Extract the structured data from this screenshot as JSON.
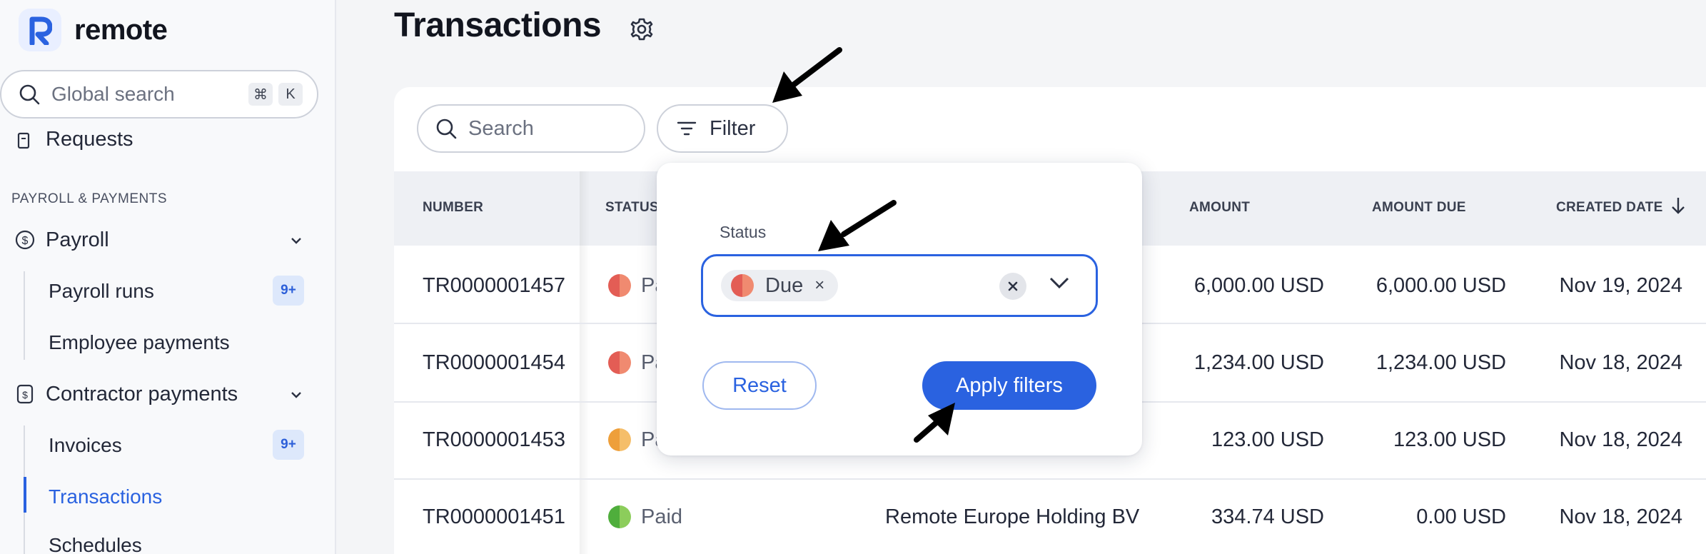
{
  "brand": {
    "name": "remote"
  },
  "global_search": {
    "placeholder": "Global search",
    "key1": "⌘",
    "key2": "K"
  },
  "sidebar": {
    "requests_label": "Requests",
    "section_label": "PAYROLL & PAYMENTS",
    "payroll_label": "Payroll",
    "payroll_runs_label": "Payroll runs",
    "payroll_runs_badge": "9+",
    "employee_payments_label": "Employee payments",
    "contractor_payments_label": "Contractor payments",
    "invoices_label": "Invoices",
    "invoices_badge": "9+",
    "transactions_label": "Transactions",
    "schedules_label": "Schedules"
  },
  "page": {
    "title": "Transactions"
  },
  "toolbar": {
    "search_placeholder": "Search",
    "filter_label": "Filter"
  },
  "table": {
    "headers": {
      "number": "NUMBER",
      "status": "STATUS",
      "amount": "AMOUNT",
      "amount_due": "AMOUNT DUE",
      "created_date": "CREATED DATE"
    },
    "rows": [
      {
        "number": "TR0000001457",
        "status": "Pa",
        "entity": "",
        "amount": "6,000.00 USD",
        "amount_due": "6,000.00 USD",
        "created": "Nov 19, 2024"
      },
      {
        "number": "TR0000001454",
        "status": "Pa",
        "entity": "",
        "amount": "1,234.00 USD",
        "amount_due": "1,234.00 USD",
        "created": "Nov 18, 2024"
      },
      {
        "number": "TR0000001453",
        "status": "Pa",
        "entity": "",
        "amount": "123.00 USD",
        "amount_due": "123.00 USD",
        "created": "Nov 18, 2024"
      },
      {
        "number": "TR0000001451",
        "status": "Paid",
        "entity": "Remote Europe Holding BV",
        "amount": "334.74 USD",
        "amount_due": "0.00 USD",
        "created": "Nov 18, 2024"
      }
    ]
  },
  "filter_popover": {
    "status_label": "Status",
    "selected_chip": "Due",
    "chip_remove": "×",
    "reset_label": "Reset",
    "apply_label": "Apply filters"
  },
  "colors": {
    "accent": "#2a62e0",
    "status_due_left": "#e35d55",
    "status_due_right": "#f08a70",
    "status_partial_left": "#ee9f3a",
    "status_partial_right": "#f5be6a",
    "status_paid_left": "#4fae3c",
    "status_paid_right": "#8ccd5b"
  }
}
